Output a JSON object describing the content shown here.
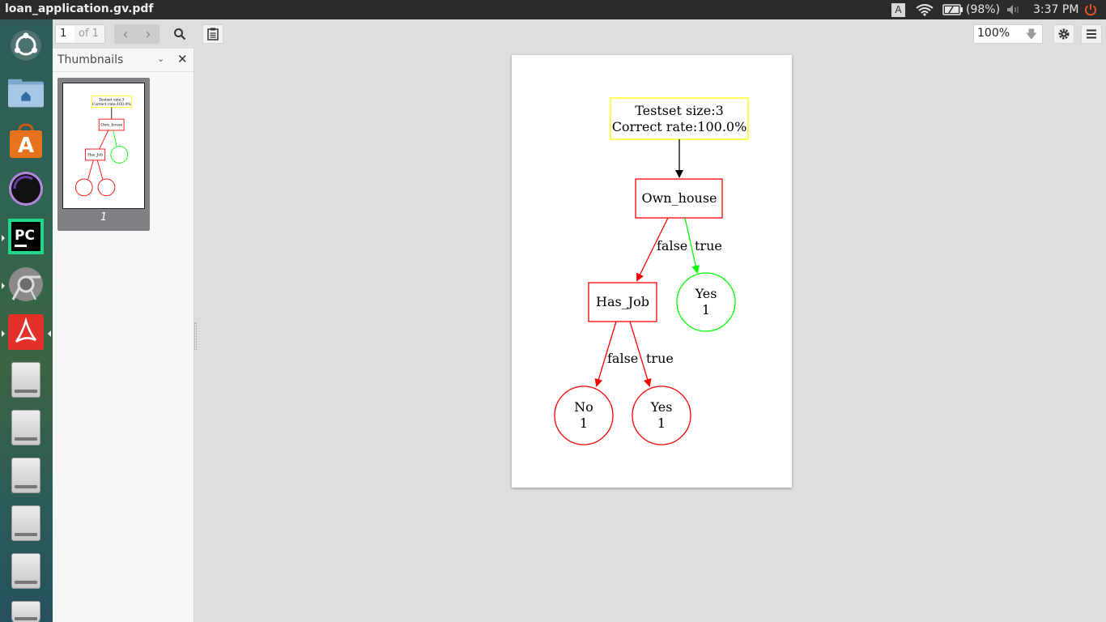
{
  "window": {
    "title": "loan_application.gv.pdf"
  },
  "tray": {
    "battery": "(98%)",
    "time": "3:37 PM",
    "keyboard": "A"
  },
  "toolbar": {
    "page_current": "1",
    "page_of": "of 1",
    "zoom": "100%"
  },
  "sidebar": {
    "title": "Thumbnails",
    "thumb_label": "1"
  },
  "launcher": {
    "icons": [
      "ubuntu-icon",
      "files-icon",
      "software-center-icon",
      "eclipse-icon",
      "pycharm-icon",
      "chrome-icon",
      "pdf-reader-icon",
      "drive-icon",
      "drive-icon",
      "drive-icon",
      "drive-icon",
      "drive-icon",
      "drive-icon"
    ]
  },
  "diagram": {
    "root_line1": "Testset size:3",
    "root_line2": "Correct rate:100.0%",
    "node_own_house": "Own_house",
    "node_has_job": "Has_Job",
    "edge_false_1": "false",
    "edge_true_1": "true",
    "leaf_yes_top_label": "Yes",
    "leaf_yes_top_count": "1",
    "edge_false_2": "false",
    "edge_true_2": "true",
    "leaf_no_label": "No",
    "leaf_no_count": "1",
    "leaf_yes_bottom_label": "Yes",
    "leaf_yes_bottom_count": "1",
    "colors": {
      "root_border": "#ffff00",
      "red": "#ff0000",
      "green": "#00ff00",
      "black": "#000000"
    }
  }
}
